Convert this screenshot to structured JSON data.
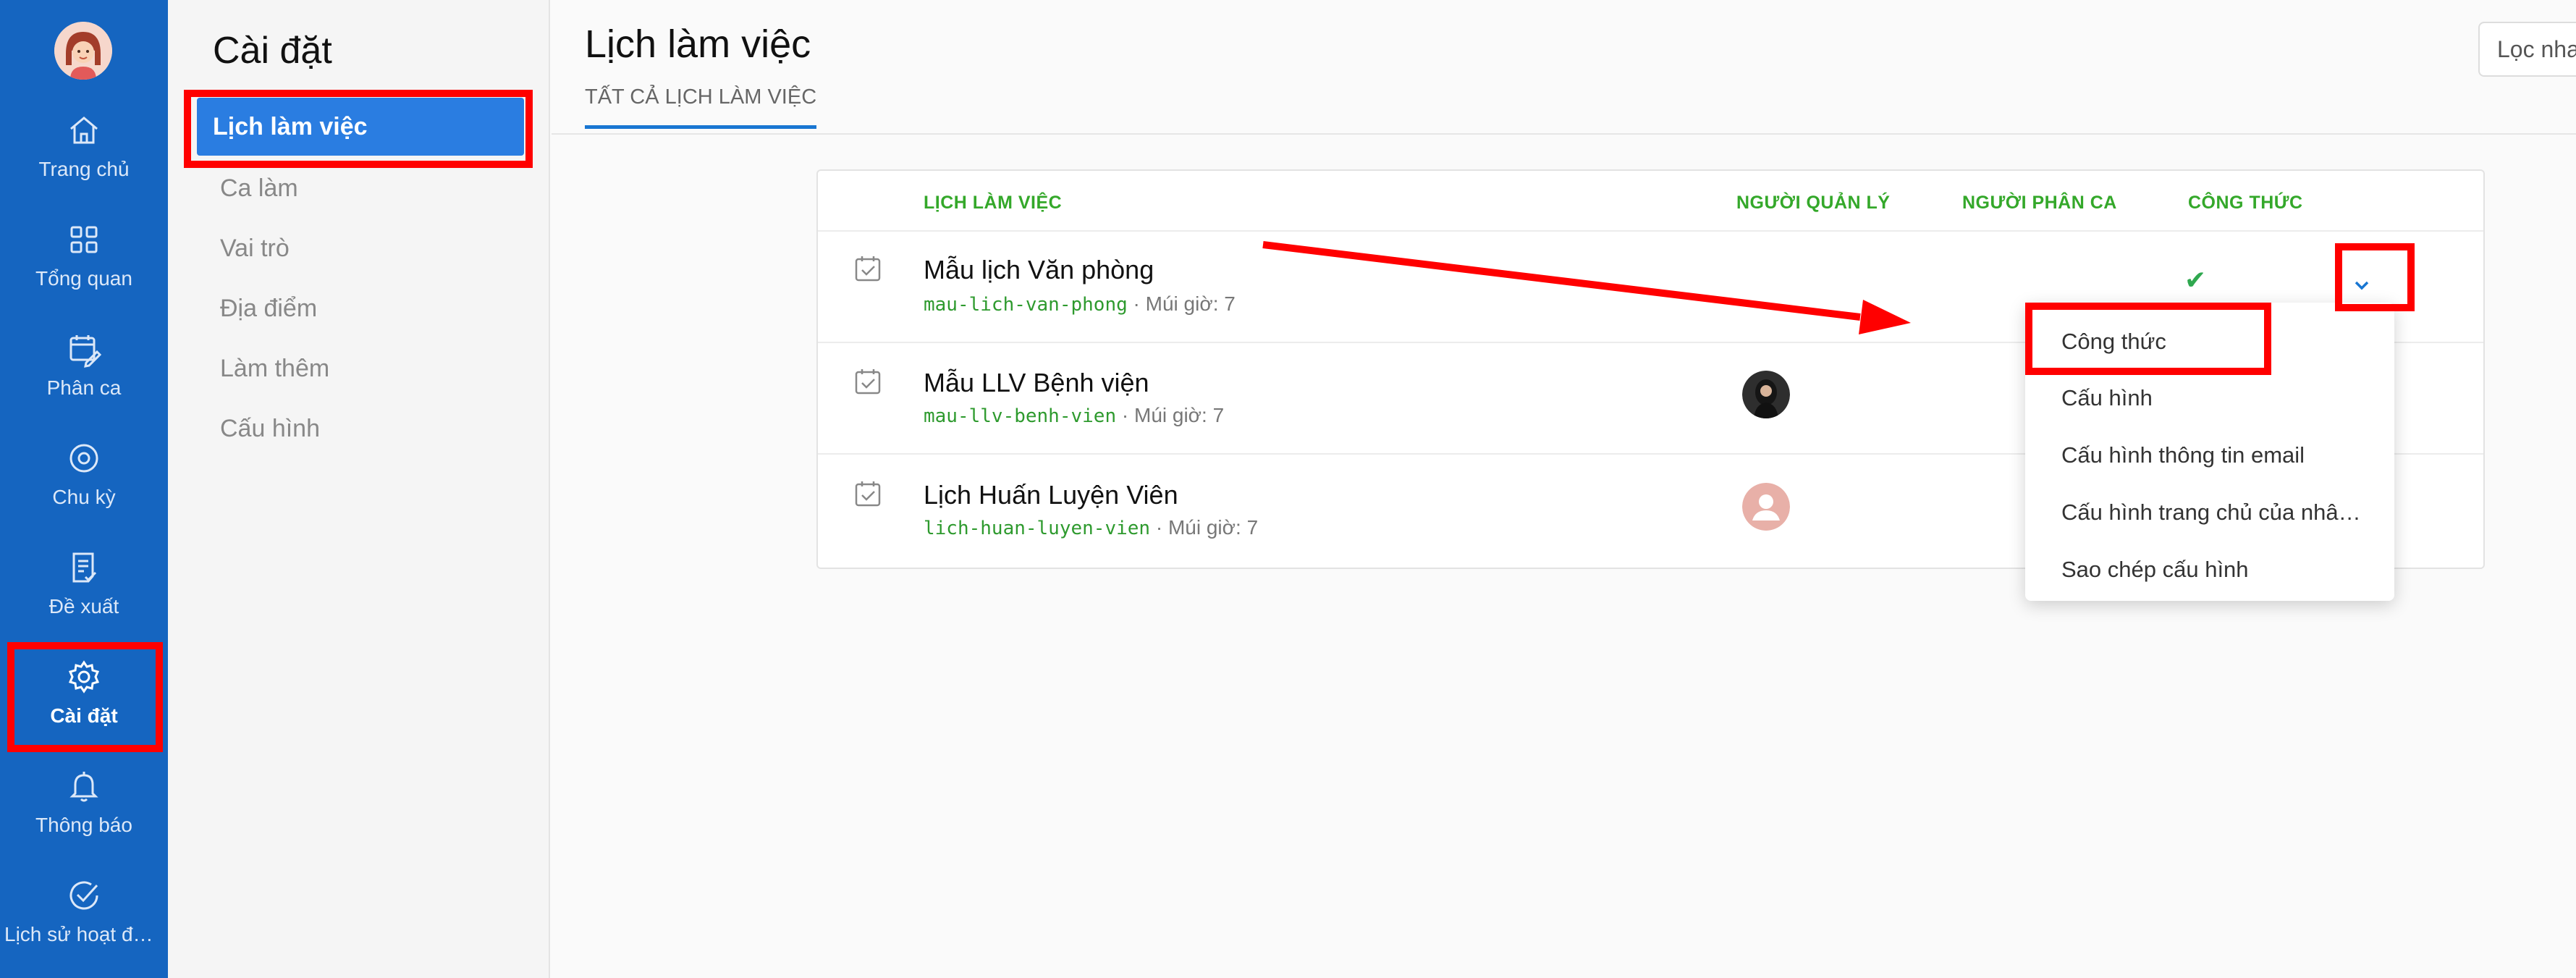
{
  "rail": {
    "items": [
      {
        "label": "Trang chủ",
        "icon": "home-icon"
      },
      {
        "label": "Tổng quan",
        "icon": "grid-icon"
      },
      {
        "label": "Phân ca",
        "icon": "calendar-edit-icon"
      },
      {
        "label": "Chu kỳ",
        "icon": "cycle-icon"
      },
      {
        "label": "Đề xuất",
        "icon": "document-icon"
      },
      {
        "label": "Cài đặt",
        "icon": "gear-icon"
      },
      {
        "label": "Thông báo",
        "icon": "bell-icon"
      },
      {
        "label": "Lịch sử hoạt động",
        "icon": "check-circle-icon"
      }
    ]
  },
  "subnav": {
    "title": "Cài đặt",
    "items": [
      "Lịch làm việc",
      "Ca làm",
      "Vai trò",
      "Địa điểm",
      "Làm thêm",
      "Cấu hình"
    ]
  },
  "main": {
    "title": "Lịch làm việc",
    "tab": "TẤT CẢ LỊCH LÀM VIỆC",
    "filter_placeholder": "Lọc nha"
  },
  "table": {
    "headers": [
      "LỊCH LÀM VIỆC",
      "NGƯỜI QUẢN LÝ",
      "NGƯỜI PHÂN CA",
      "CÔNG THỨC"
    ],
    "rows": [
      {
        "name": "Mẫu lịch Văn phòng",
        "slug": "mau-lich-van-phong",
        "tz": " · Múi giờ: 7"
      },
      {
        "name": "Mẫu LLV Bệnh viện",
        "slug": "mau-llv-benh-vien",
        "tz": " · Múi giờ: 7"
      },
      {
        "name": "Lịch Huấn Luyện Viên",
        "slug": "lich-huan-luyen-vien",
        "tz": " · Múi giờ: 7"
      }
    ],
    "check_symbol": "✔"
  },
  "menu": {
    "items": [
      "Công thức",
      "Cấu hình",
      "Cấu hình thông tin email",
      "Cấu hình trang chủ của nhâ…",
      "Sao chép cấu hình"
    ]
  },
  "colors": {
    "rail": "#1565c0",
    "accent": "#2a7de1",
    "header_green": "#34a82a",
    "annotation_red": "#ff0000"
  }
}
